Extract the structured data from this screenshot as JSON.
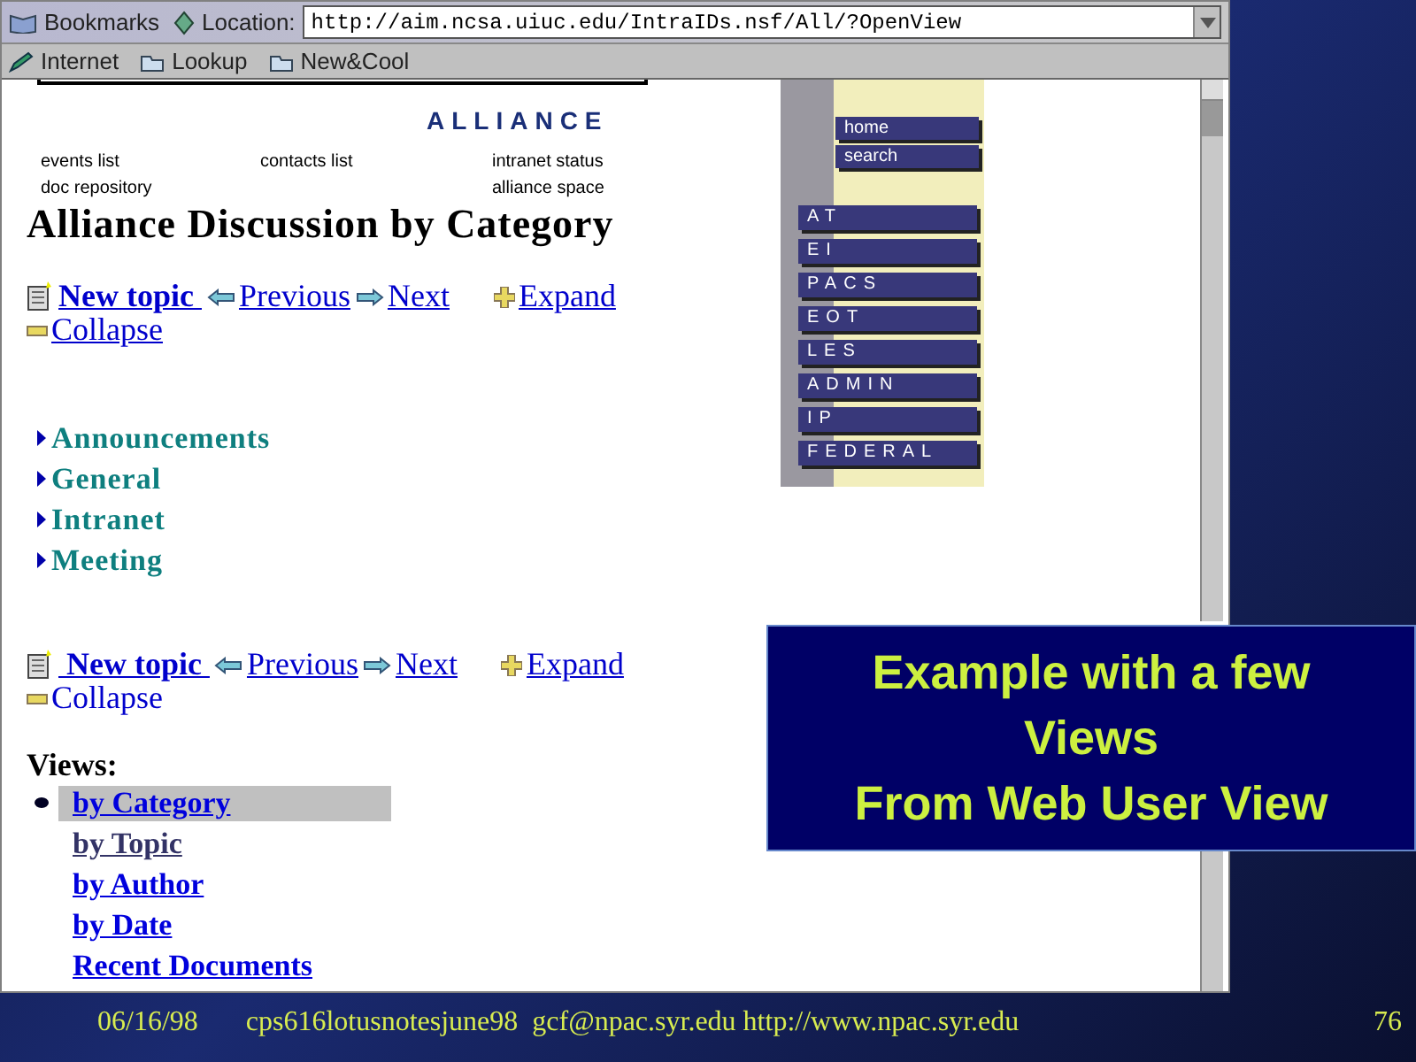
{
  "browser": {
    "bookmarks": "Bookmarks",
    "location_label": "Location:",
    "url": "http://aim.ncsa.uiuc.edu/IntraIDs.nsf/All/?OpenView",
    "personal_toolbar": [
      "Internet",
      "Lookup",
      "New&Cool"
    ]
  },
  "page": {
    "banner": "ALLIANCE",
    "header_link_columns": [
      [
        "events list",
        "doc repository"
      ],
      [
        "contacts list"
      ],
      [
        "intranet status",
        "alliance space"
      ]
    ],
    "title": "Alliance Discussion by Category",
    "toolbar_top": [
      {
        "kind": "new",
        "label": "New topic ",
        "underlined": true
      },
      {
        "kind": "previous",
        "label": "Previous",
        "underlined": true
      },
      {
        "kind": "next",
        "label": "Next",
        "underlined": true
      },
      {
        "kind": "expand",
        "label": "Expand",
        "underlined": true
      },
      {
        "kind": "collapse",
        "label": "Collapse",
        "underlined": true
      }
    ],
    "categories": [
      "Announcements",
      "General",
      "Intranet",
      "Meeting"
    ],
    "toolbar_bottom": [
      {
        "kind": "new",
        "label": " New topic ",
        "underlined": true
      },
      {
        "kind": "previous",
        "label": "Previous",
        "underlined": true
      },
      {
        "kind": "next",
        "label": "Next",
        "underlined": true
      },
      {
        "kind": "expand",
        "label": "Expand",
        "underlined": true
      },
      {
        "kind": "collapse",
        "label": "Collapse",
        "underlined": false
      }
    ],
    "views_heading": "Views:",
    "views": [
      {
        "label": "by Category",
        "selected": true,
        "visited": false
      },
      {
        "label": "by Topic",
        "selected": false,
        "visited": true
      },
      {
        "label": "by Author",
        "selected": false,
        "visited": false
      },
      {
        "label": "by Date",
        "selected": false,
        "visited": false
      },
      {
        "label": "Recent Documents",
        "selected": false,
        "visited": false
      }
    ],
    "sidebar": {
      "small_buttons": [
        "home",
        "search"
      ],
      "buttons": [
        "AT",
        "EI",
        "PACS",
        "EOT",
        "LES",
        "ADMIN",
        "IP",
        "FEDERAL"
      ]
    }
  },
  "callout": {
    "lines": [
      "Example with a few",
      "Views",
      "From Web User View"
    ]
  },
  "footer": {
    "date": "06/16/98",
    "name": "cps616lotusnotesjune98",
    "contact": "gcf@npac.syr.edu http://www.npac.syr.edu",
    "page": "76"
  }
}
